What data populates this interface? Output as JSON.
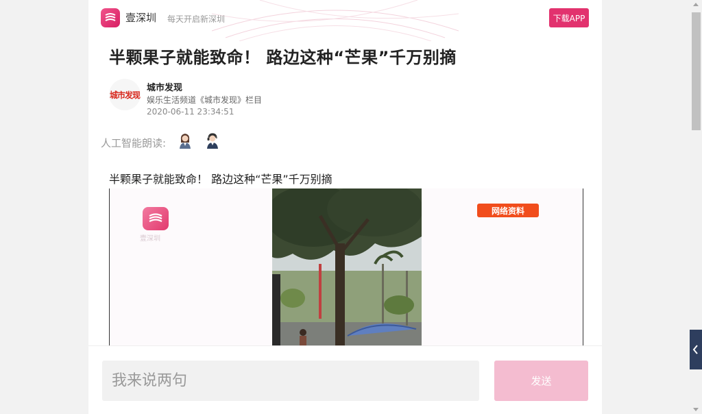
{
  "header": {
    "app_name": "壹深圳",
    "slogan": "每天开启新深圳",
    "download_label": "下载APP"
  },
  "article": {
    "title": "半颗果子就能致命！ 路边这种“芒果”千万别摘",
    "author": {
      "avatar_text": "城市发现",
      "name": "城市发现",
      "channel": "娱乐生活频道《城市发现》栏目",
      "datetime": "2020-06-11 23:34:51"
    },
    "ai_read_label": "人工智能朗读:",
    "voices": [
      "female-voice-icon",
      "male-voice-icon"
    ],
    "subtitle": "半颗果子就能致命！ 路边这种“芒果”千万别摘",
    "video": {
      "watermark_text": "壹深圳",
      "badge": "网络资料"
    }
  },
  "comment": {
    "placeholder": "我来说两句",
    "send_label": "发送"
  },
  "colors": {
    "brand": "#e2326e",
    "send_disabled": "#f4bcd0",
    "badge": "#f14d1c",
    "side_tab": "#2e3e5e"
  }
}
